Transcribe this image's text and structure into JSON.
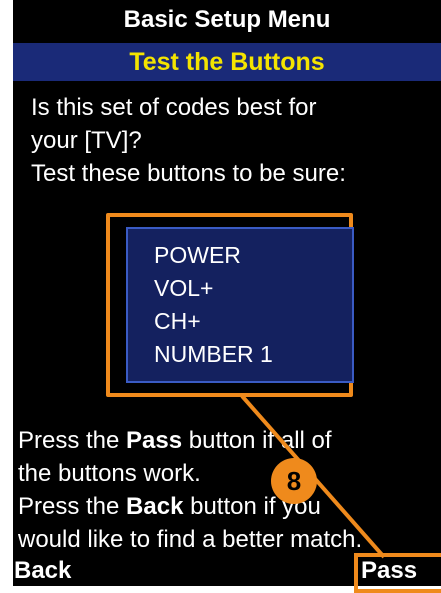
{
  "header": {
    "menu_title": "Basic Setup Menu",
    "screen_title": "Test the Buttons"
  },
  "intro": {
    "line1": "Is this set of codes best for",
    "line2": "your [TV]?",
    "line3": "Test these buttons to be sure:"
  },
  "test_buttons": [
    "POWER",
    "VOL+",
    "CH+",
    "NUMBER 1"
  ],
  "instructions": {
    "line1_pre": "Press the ",
    "line1_bold": "Pass",
    "line1_post": " button if all of",
    "line2": "the buttons work.",
    "line3_pre": "Press the ",
    "line3_bold": "Back",
    "line3_post": " button if you",
    "line4": "would like to find a better match."
  },
  "softkeys": {
    "left": "Back",
    "right": "Pass"
  },
  "callout": {
    "number": "8"
  },
  "colors": {
    "background": "#000000",
    "title_bar": "#1a2a78",
    "title_text": "#f4e400",
    "highlight": "#ef8a1c",
    "list_box": "#14215f",
    "list_border": "#3a5bc4"
  }
}
